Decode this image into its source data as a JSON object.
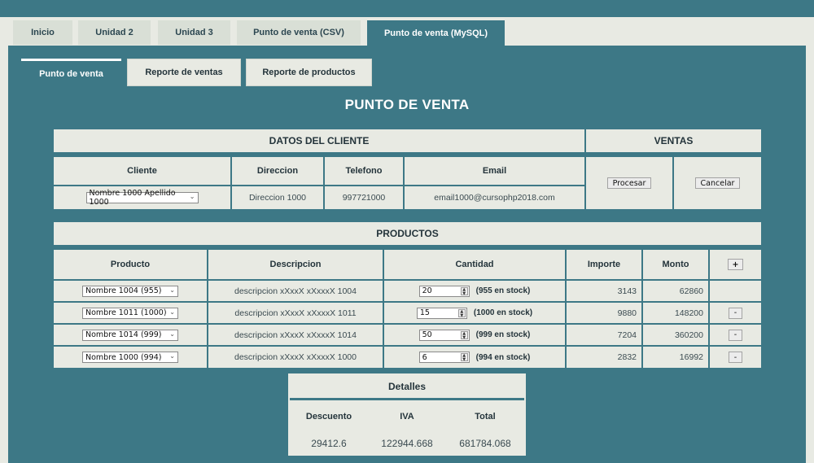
{
  "outer_tabs": [
    "Inicio",
    "Unidad 2",
    "Unidad 3",
    "Punto de venta (CSV)",
    "Punto de venta (MySQL)"
  ],
  "inner_tabs": [
    "Punto de venta",
    "Reporte de ventas",
    "Reporte de productos"
  ],
  "page_title": "PUNTO DE VENTA",
  "cliente": {
    "section": "DATOS DEL CLIENTE",
    "headers": [
      "Cliente",
      "Direccion",
      "Telefono",
      "Email"
    ],
    "selected": "Nombre 1000 Apellido 1000",
    "direccion": "Direccion 1000",
    "telefono": "997721000",
    "email": "email1000@cursophp2018.com"
  },
  "ventas": {
    "section": "VENTAS",
    "procesar": "Procesar",
    "cancelar": "Cancelar"
  },
  "productos": {
    "section": "PRODUCTOS",
    "headers": [
      "Producto",
      "Descripcion",
      "Cantidad",
      "Importe",
      "Monto"
    ],
    "add": "+",
    "remove": "-",
    "rows": [
      {
        "producto": "Nombre 1004 (955)",
        "descripcion": "descripcion xXxxX xXxxxX 1004",
        "cantidad": "20",
        "stock": "(955 en stock)",
        "importe": "3143",
        "monto": "62860"
      },
      {
        "producto": "Nombre 1011 (1000)",
        "descripcion": "descripcion xXxxX xXxxxX 1011",
        "cantidad": "15",
        "stock": "(1000 en stock)",
        "importe": "9880",
        "monto": "148200"
      },
      {
        "producto": "Nombre 1014 (999)",
        "descripcion": "descripcion xXxxX xXxxxX 1014",
        "cantidad": "50",
        "stock": "(999 en stock)",
        "importe": "7204",
        "monto": "360200"
      },
      {
        "producto": "Nombre 1000 (994)",
        "descripcion": "descripcion xXxxX xXxxxX 1000",
        "cantidad": "6",
        "stock": "(994 en stock)",
        "importe": "2832",
        "monto": "16992"
      }
    ]
  },
  "detalles": {
    "title": "Detalles",
    "headers": [
      "Descuento",
      "IVA",
      "Total"
    ],
    "values": [
      "29412.6",
      "122944.668",
      "681784.068"
    ]
  },
  "colors": {
    "accent": "#3d7886",
    "surface": "#e8eae3",
    "text": "#24343b"
  }
}
